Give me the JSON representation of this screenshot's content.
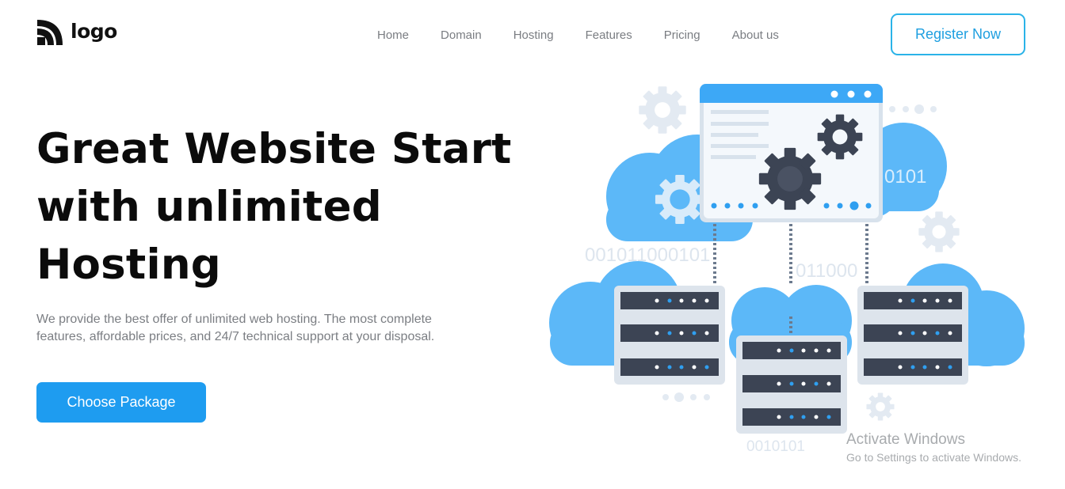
{
  "header": {
    "logo_text": "logo",
    "nav": [
      {
        "label": "Home"
      },
      {
        "label": "Domain"
      },
      {
        "label": "Hosting"
      },
      {
        "label": "Features"
      },
      {
        "label": "Pricing"
      },
      {
        "label": "About us"
      }
    ],
    "register_label": "Register Now"
  },
  "hero": {
    "title_line1": "Great Website Start",
    "title_line2": "with unlimited",
    "title_line3": "Hosting",
    "description": "We provide the best offer of unlimited web hosting. The most complete features, affordable prices, and 24/7 technical support at your disposal.",
    "cta_label": "Choose Package"
  },
  "illustration": {
    "binary_1": "001011000101",
    "binary_2": "011000",
    "binary_3": "0101",
    "binary_4": "0010101",
    "icons": [
      "cloud-icon",
      "server-icon",
      "gear-icon",
      "browser-window-icon"
    ]
  },
  "watermark": {
    "title": "Activate Windows",
    "subtitle": "Go to Settings to activate Windows."
  },
  "colors": {
    "accent": "#1e9cf0",
    "accent_border": "#2ab3e8",
    "cloud": "#5cb8f8",
    "cloud_light": "#8fd0fb",
    "server_dark": "#3c4454",
    "gear_light": "#e3eaf2",
    "title": "#0b0b0b",
    "muted": "#7b7e83"
  }
}
